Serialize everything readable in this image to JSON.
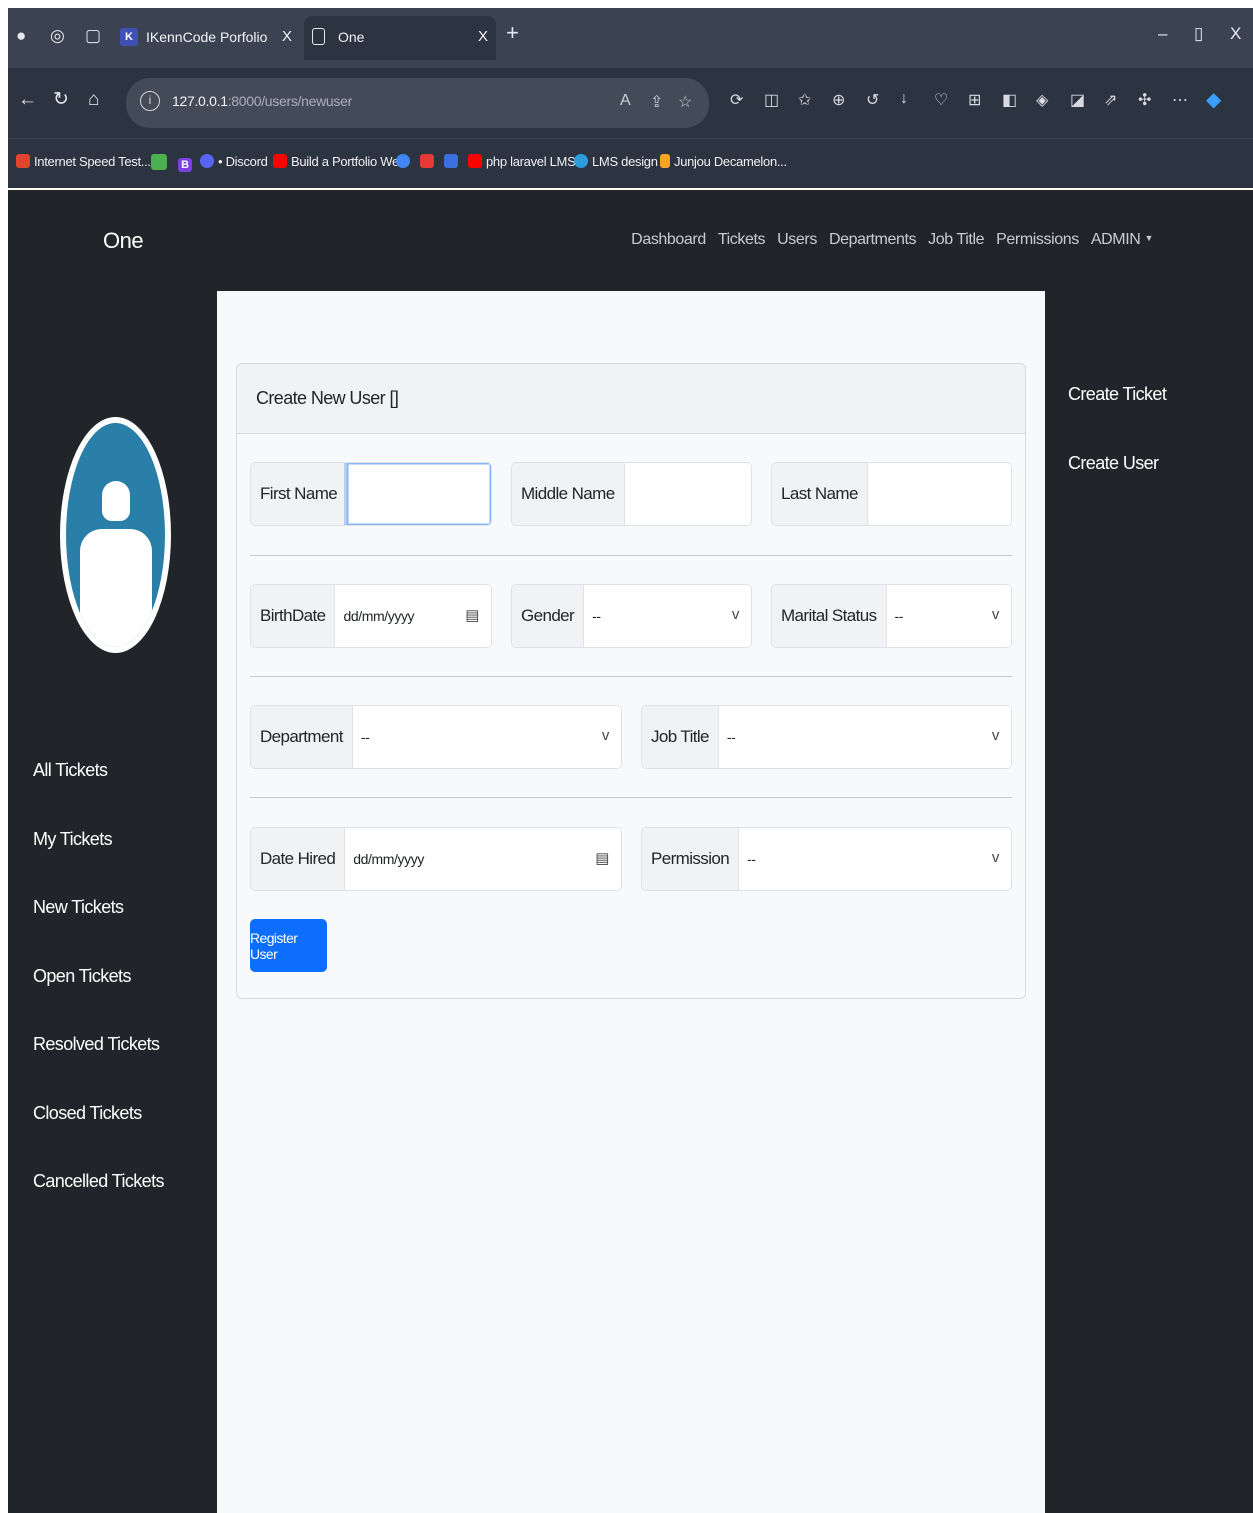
{
  "browser": {
    "tabs": [
      {
        "title": "IKennCode Porfolio",
        "close": "X",
        "favicon": "K"
      },
      {
        "title": "One",
        "close": "X"
      }
    ],
    "new_tab": "+",
    "window_controls": {
      "minimize": "–",
      "restore": "▯",
      "close": "X"
    },
    "url": {
      "host": "127.0.0.1",
      "rest": ":8000/users/newuser"
    },
    "bookmarks": [
      {
        "label": "Internet Speed Test...",
        "color": "#e0442f"
      },
      {
        "label": "",
        "color": "#4caf50"
      },
      {
        "label": "B",
        "color": "#7b3fe4"
      },
      {
        "label": "• Discord",
        "color": "#5865f2"
      },
      {
        "label": "Build a Portfolio We...",
        "color": "#ff0000"
      },
      {
        "label": "",
        "color": "#4285f4"
      },
      {
        "label": "",
        "color": "#e53935"
      },
      {
        "label": "",
        "color": "#3d6ee0"
      },
      {
        "label": "php laravel LMS",
        "color": "#ff0000"
      },
      {
        "label": "LMS design",
        "color": "#2d9cdb"
      },
      {
        "label": "Junjou Decamelon...",
        "color": "#f5a623"
      }
    ]
  },
  "app": {
    "brand": "One",
    "nav": [
      "Dashboard",
      "Tickets",
      "Users",
      "Departments",
      "Job Title",
      "Permissions"
    ],
    "admin_label": "ADMIN",
    "sidebar": [
      "All Tickets",
      "My Tickets",
      "New Tickets",
      "Open Tickets",
      "Resolved Tickets",
      "Closed Tickets",
      "Cancelled Tickets"
    ],
    "right_menu": [
      "Create Ticket",
      "Create User"
    ]
  },
  "form": {
    "header": "Create New User []",
    "first_name": {
      "label": "First Name",
      "value": ""
    },
    "middle_name": {
      "label": "Middle Name",
      "value": ""
    },
    "last_name": {
      "label": "Last Name",
      "value": ""
    },
    "birth_date": {
      "label": "BirthDate",
      "value": "dd/mm/yyyy"
    },
    "gender": {
      "label": "Gender",
      "value": "--"
    },
    "marital_status": {
      "label": "Marital Status",
      "value": "--"
    },
    "department": {
      "label": "Department",
      "value": "--"
    },
    "job_title": {
      "label": "Job Title",
      "value": "--"
    },
    "date_hired": {
      "label": "Date Hired",
      "value": "dd/mm/yyyy"
    },
    "permission": {
      "label": "Permission",
      "value": "--"
    },
    "submit": "Register User"
  },
  "colors": {
    "primary": "#0d6efd",
    "page_bg": "#212529",
    "avatar": "#2a7fa8"
  }
}
